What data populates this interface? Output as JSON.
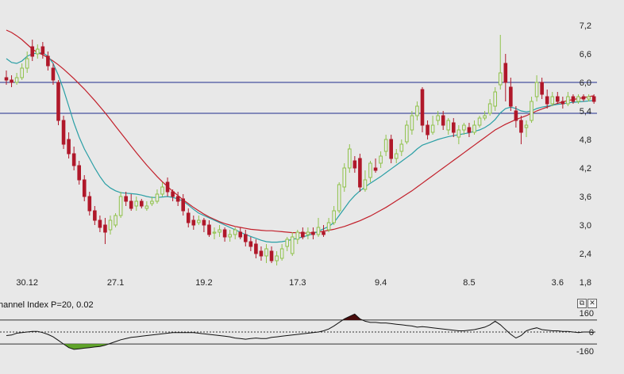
{
  "colors": {
    "background": "#e8e8e8",
    "up_candle": "#8fc24a",
    "down_candle": "#b0182a",
    "ma_short": "#2a9fa5",
    "ma_long": "#c21f2a",
    "hline": "#1e2b8c",
    "cci_line": "#111111",
    "cci_neg_fill": "#5fa32a",
    "cci_pos_fill": "#4a0c0c"
  },
  "indicator": {
    "title": "hannel Index P=20, 0.02",
    "buttons": [
      {
        "name": "maximize-icon",
        "glyph": "⧉"
      },
      {
        "name": "close-icon",
        "glyph": "✕"
      }
    ]
  },
  "chart_data": [
    {
      "type": "candlestick",
      "y_axis_labels": [
        "7,2",
        "6,6",
        "6,0",
        "5,4",
        "4,8",
        "4,2",
        "3,6",
        "3,0",
        "2,4",
        "1,8"
      ],
      "y_axis_values": [
        7.2,
        6.6,
        6.0,
        5.4,
        4.8,
        4.2,
        3.6,
        3.0,
        2.4,
        1.8
      ],
      "ylim": [
        1.8,
        7.5
      ],
      "x_axis_labels": [
        "30.12",
        "27.1",
        "19.2",
        "17.3",
        "9.4",
        "8.5",
        "3.6"
      ],
      "x_axis_label_index": [
        4,
        21,
        38,
        56,
        72,
        89,
        106
      ],
      "horizontal_lines": [
        6.0,
        5.35
      ],
      "candles": [
        [
          6.1,
          6.05,
          6.25,
          5.95
        ],
        [
          6.05,
          6.0,
          6.15,
          5.9
        ],
        [
          6.0,
          6.1,
          6.2,
          5.95
        ],
        [
          6.1,
          6.3,
          6.4,
          6.05
        ],
        [
          6.3,
          6.5,
          6.65,
          6.2
        ],
        [
          6.75,
          6.55,
          6.9,
          6.45
        ],
        [
          6.6,
          6.7,
          6.8,
          6.5
        ],
        [
          6.75,
          6.6,
          6.85,
          6.5
        ],
        [
          6.55,
          6.35,
          6.65,
          6.25
        ],
        [
          6.3,
          6.05,
          6.4,
          5.95
        ],
        [
          6.0,
          5.2,
          6.05,
          5.1
        ],
        [
          5.2,
          4.7,
          5.3,
          4.6
        ],
        [
          4.8,
          4.5,
          4.95,
          4.4
        ],
        [
          4.5,
          4.25,
          4.65,
          4.15
        ],
        [
          4.25,
          3.95,
          4.35,
          3.85
        ],
        [
          3.95,
          3.6,
          4.05,
          3.5
        ],
        [
          3.6,
          3.3,
          3.7,
          3.2
        ],
        [
          3.3,
          3.1,
          3.4,
          3.0
        ],
        [
          3.1,
          2.95,
          3.2,
          2.85
        ],
        [
          3.0,
          2.85,
          3.15,
          2.6
        ],
        [
          2.9,
          3.1,
          3.2,
          2.8
        ],
        [
          3.0,
          3.2,
          3.25,
          2.95
        ],
        [
          3.2,
          3.6,
          3.7,
          3.15
        ],
        [
          3.6,
          3.5,
          3.7,
          3.4
        ],
        [
          3.5,
          3.35,
          3.65,
          3.3
        ],
        [
          3.4,
          3.5,
          3.6,
          3.3
        ],
        [
          3.5,
          3.4,
          3.55,
          3.35
        ],
        [
          3.35,
          3.4,
          3.5,
          3.3
        ],
        [
          3.45,
          3.5,
          3.6,
          3.4
        ],
        [
          3.5,
          3.65,
          3.75,
          3.45
        ],
        [
          3.65,
          3.8,
          3.9,
          3.6
        ],
        [
          3.9,
          3.7,
          4.0,
          3.6
        ],
        [
          3.7,
          3.6,
          3.75,
          3.5
        ],
        [
          3.6,
          3.5,
          3.7,
          3.4
        ],
        [
          3.55,
          3.3,
          3.65,
          3.2
        ],
        [
          3.25,
          3.05,
          3.35,
          2.95
        ],
        [
          3.1,
          3.0,
          3.2,
          2.9
        ],
        [
          3.05,
          3.1,
          3.2,
          3.0
        ],
        [
          3.1,
          3.0,
          3.15,
          2.85
        ],
        [
          3.0,
          2.8,
          3.1,
          2.75
        ],
        [
          2.85,
          2.85,
          2.95,
          2.7
        ],
        [
          2.85,
          2.9,
          3.0,
          2.75
        ],
        [
          2.9,
          2.75,
          2.95,
          2.65
        ],
        [
          2.75,
          2.8,
          2.9,
          2.65
        ],
        [
          2.8,
          2.9,
          2.95,
          2.7
        ],
        [
          2.85,
          2.75,
          2.95,
          2.7
        ],
        [
          2.8,
          2.65,
          2.9,
          2.55
        ],
        [
          2.65,
          2.55,
          2.75,
          2.45
        ],
        [
          2.6,
          2.4,
          2.7,
          2.3
        ],
        [
          2.45,
          2.35,
          2.55,
          2.25
        ],
        [
          2.35,
          2.5,
          2.6,
          2.2
        ],
        [
          2.45,
          2.25,
          2.55,
          2.2
        ],
        [
          2.25,
          2.35,
          2.45,
          2.15
        ],
        [
          2.3,
          2.5,
          2.6,
          2.25
        ],
        [
          2.55,
          2.7,
          2.75,
          2.45
        ],
        [
          2.4,
          2.75,
          2.85,
          2.35
        ],
        [
          2.7,
          2.85,
          2.9,
          2.6
        ],
        [
          2.85,
          2.75,
          2.95,
          2.7
        ],
        [
          2.8,
          2.85,
          2.95,
          2.7
        ],
        [
          2.85,
          2.8,
          2.95,
          2.7
        ],
        [
          2.8,
          2.95,
          3.15,
          2.75
        ],
        [
          2.85,
          2.8,
          3.0,
          2.75
        ],
        [
          2.9,
          3.05,
          3.15,
          2.85
        ],
        [
          3.05,
          3.3,
          3.4,
          3.0
        ],
        [
          3.3,
          3.85,
          3.9,
          3.25
        ],
        [
          3.8,
          4.2,
          4.3,
          3.7
        ],
        [
          4.2,
          4.6,
          4.7,
          4.1
        ],
        [
          4.35,
          4.2,
          4.45,
          4.1
        ],
        [
          4.4,
          3.8,
          4.5,
          3.7
        ],
        [
          3.75,
          3.95,
          4.15,
          3.7
        ],
        [
          4.0,
          4.3,
          4.35,
          3.9
        ],
        [
          4.2,
          4.15,
          4.4,
          4.1
        ],
        [
          4.3,
          4.45,
          4.55,
          4.2
        ],
        [
          4.55,
          4.8,
          4.9,
          4.45
        ],
        [
          4.8,
          4.4,
          4.9,
          4.3
        ],
        [
          4.4,
          4.5,
          4.6,
          4.3
        ],
        [
          4.55,
          4.7,
          4.8,
          4.45
        ],
        [
          4.75,
          5.1,
          5.2,
          4.7
        ],
        [
          5.0,
          5.3,
          5.4,
          4.9
        ],
        [
          5.3,
          5.5,
          5.6,
          5.2
        ],
        [
          5.85,
          5.1,
          5.9,
          4.95
        ],
        [
          5.1,
          4.9,
          5.2,
          4.8
        ],
        [
          4.95,
          5.1,
          5.3,
          4.9
        ],
        [
          5.2,
          5.3,
          5.4,
          5.1
        ],
        [
          5.3,
          5.1,
          5.4,
          5.0
        ],
        [
          5.0,
          5.2,
          5.25,
          4.9
        ],
        [
          5.15,
          4.95,
          5.25,
          4.85
        ],
        [
          4.85,
          5.0,
          5.1,
          4.7
        ],
        [
          5.0,
          5.1,
          5.15,
          4.9
        ],
        [
          5.05,
          4.95,
          5.15,
          4.85
        ],
        [
          4.95,
          5.1,
          5.2,
          4.9
        ],
        [
          5.1,
          5.25,
          5.3,
          5.05
        ],
        [
          5.25,
          5.3,
          5.4,
          5.2
        ],
        [
          5.35,
          5.55,
          5.65,
          5.3
        ],
        [
          5.5,
          5.8,
          5.9,
          5.4
        ],
        [
          5.95,
          6.2,
          7.0,
          5.85
        ],
        [
          6.4,
          6.0,
          6.6,
          5.6
        ],
        [
          5.9,
          5.5,
          6.1,
          5.4
        ],
        [
          5.4,
          5.2,
          5.5,
          5.05
        ],
        [
          5.2,
          4.95,
          5.3,
          4.7
        ],
        [
          5.05,
          5.1,
          5.2,
          4.85
        ],
        [
          5.2,
          5.6,
          5.7,
          5.15
        ],
        [
          5.7,
          6.0,
          6.15,
          5.6
        ],
        [
          6.0,
          5.75,
          6.1,
          5.65
        ],
        [
          5.7,
          5.55,
          5.85,
          5.45
        ],
        [
          5.55,
          5.7,
          5.8,
          5.5
        ],
        [
          5.7,
          5.6,
          5.8,
          5.55
        ],
        [
          5.6,
          5.55,
          5.7,
          5.45
        ],
        [
          5.55,
          5.7,
          5.8,
          5.5
        ],
        [
          5.7,
          5.6,
          5.75,
          5.55
        ],
        [
          5.6,
          5.7,
          5.75,
          5.55
        ],
        [
          5.7,
          5.65,
          5.75,
          5.6
        ],
        [
          5.65,
          5.7,
          5.75,
          5.6
        ],
        [
          5.7,
          5.6,
          5.75,
          5.55
        ]
      ],
      "ma_short": [
        6.5,
        6.42,
        6.4,
        6.45,
        6.55,
        6.6,
        6.62,
        6.62,
        6.55,
        6.4,
        6.15,
        5.85,
        5.5,
        5.15,
        4.85,
        4.6,
        4.4,
        4.2,
        4.02,
        3.87,
        3.78,
        3.72,
        3.68,
        3.67,
        3.66,
        3.65,
        3.63,
        3.6,
        3.58,
        3.58,
        3.59,
        3.6,
        3.58,
        3.55,
        3.5,
        3.42,
        3.33,
        3.25,
        3.2,
        3.15,
        3.1,
        3.05,
        3.0,
        2.95,
        2.9,
        2.85,
        2.8,
        2.76,
        2.72,
        2.68,
        2.65,
        2.64,
        2.64,
        2.65,
        2.67,
        2.7,
        2.72,
        2.75,
        2.78,
        2.82,
        2.87,
        2.92,
        2.97,
        3.05,
        3.2,
        3.35,
        3.5,
        3.62,
        3.72,
        3.8,
        3.88,
        3.95,
        4.02,
        4.1,
        4.18,
        4.26,
        4.34,
        4.42,
        4.5,
        4.6,
        4.68,
        4.72,
        4.76,
        4.8,
        4.83,
        4.86,
        4.88,
        4.9,
        4.92,
        4.94,
        4.97,
        5.0,
        5.05,
        5.12,
        5.22,
        5.36,
        5.45,
        5.48,
        5.45,
        5.4,
        5.38,
        5.4,
        5.45,
        5.48,
        5.5,
        5.52,
        5.54,
        5.55,
        5.57,
        5.58,
        5.59,
        5.6,
        5.61,
        5.62
      ],
      "ma_long": [
        7.1,
        7.05,
        6.98,
        6.9,
        6.8,
        6.7,
        6.63,
        6.58,
        6.52,
        6.45,
        6.37,
        6.28,
        6.18,
        6.08,
        5.97,
        5.86,
        5.74,
        5.62,
        5.49,
        5.36,
        5.22,
        5.08,
        4.94,
        4.8,
        4.66,
        4.52,
        4.39,
        4.26,
        4.14,
        4.02,
        3.91,
        3.81,
        3.71,
        3.62,
        3.53,
        3.45,
        3.37,
        3.3,
        3.23,
        3.17,
        3.12,
        3.07,
        3.03,
        3.0,
        2.97,
        2.95,
        2.93,
        2.91,
        2.9,
        2.89,
        2.88,
        2.88,
        2.87,
        2.86,
        2.85,
        2.84,
        2.84,
        2.83,
        2.83,
        2.84,
        2.85,
        2.87,
        2.89,
        2.91,
        2.94,
        2.97,
        3.01,
        3.05,
        3.09,
        3.14,
        3.19,
        3.25,
        3.31,
        3.37,
        3.44,
        3.51,
        3.58,
        3.65,
        3.72,
        3.8,
        3.88,
        3.96,
        4.04,
        4.12,
        4.2,
        4.28,
        4.36,
        4.44,
        4.52,
        4.6,
        4.68,
        4.76,
        4.84,
        4.92,
        5.0,
        5.06,
        5.12,
        5.17,
        5.22,
        5.26,
        5.3,
        5.35,
        5.4,
        5.44,
        5.48,
        5.52,
        5.56,
        5.59,
        5.62,
        5.64,
        5.66,
        5.68,
        5.7,
        5.72
      ]
    },
    {
      "type": "line",
      "name": "Commodity Channel Index",
      "y_axis_labels": [
        "160",
        "0",
        "-160"
      ],
      "y_axis_values": [
        160,
        0,
        -160
      ],
      "ylim": [
        -185,
        185
      ],
      "horizontal_lines": [
        100,
        0,
        -100
      ],
      "values": [
        -30,
        -25,
        -10,
        -5,
        0,
        5,
        5,
        -5,
        -20,
        -40,
        -70,
        -100,
        -130,
        -145,
        -140,
        -135,
        -130,
        -125,
        -120,
        -110,
        -95,
        -80,
        -65,
        -55,
        -45,
        -40,
        -35,
        -30,
        -25,
        -20,
        -15,
        -10,
        -5,
        -5,
        -5,
        -5,
        -5,
        -10,
        -15,
        -20,
        -25,
        -30,
        -35,
        -40,
        -50,
        -55,
        -60,
        -55,
        -50,
        -55,
        -55,
        -45,
        -40,
        -35,
        -30,
        -25,
        -20,
        -15,
        -10,
        -5,
        0,
        10,
        25,
        50,
        80,
        110,
        130,
        150,
        110,
        90,
        80,
        80,
        75,
        75,
        70,
        65,
        60,
        55,
        50,
        40,
        45,
        40,
        35,
        30,
        25,
        20,
        15,
        10,
        10,
        15,
        20,
        30,
        40,
        60,
        90,
        60,
        20,
        -20,
        -50,
        -30,
        10,
        25,
        35,
        20,
        15,
        10,
        10,
        5,
        5,
        0,
        -5,
        0,
        0,
        -5
      ]
    }
  ]
}
